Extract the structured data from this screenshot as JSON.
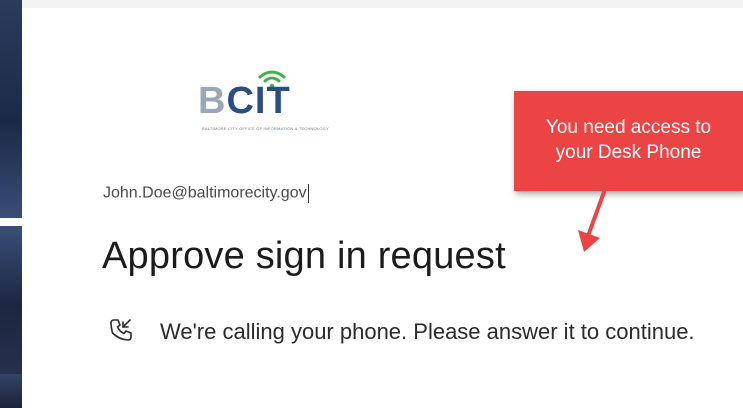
{
  "logo": {
    "brand_b": "B",
    "brand_cit": "CIT",
    "tagline": "BALTIMORE CITY OFFICE OF INFORMATION & TECHNOLOGY"
  },
  "account": {
    "email": "John.Doe@baltimorecity.gov"
  },
  "heading": "Approve sign in request",
  "message": "We're calling your phone. Please answer it to continue.",
  "callout": {
    "line1": "You need access to",
    "line2": "your Desk Phone",
    "color": "#ec4444"
  },
  "icons": {
    "call": "phone-incoming-call-icon",
    "wifi": "wifi-icon"
  }
}
